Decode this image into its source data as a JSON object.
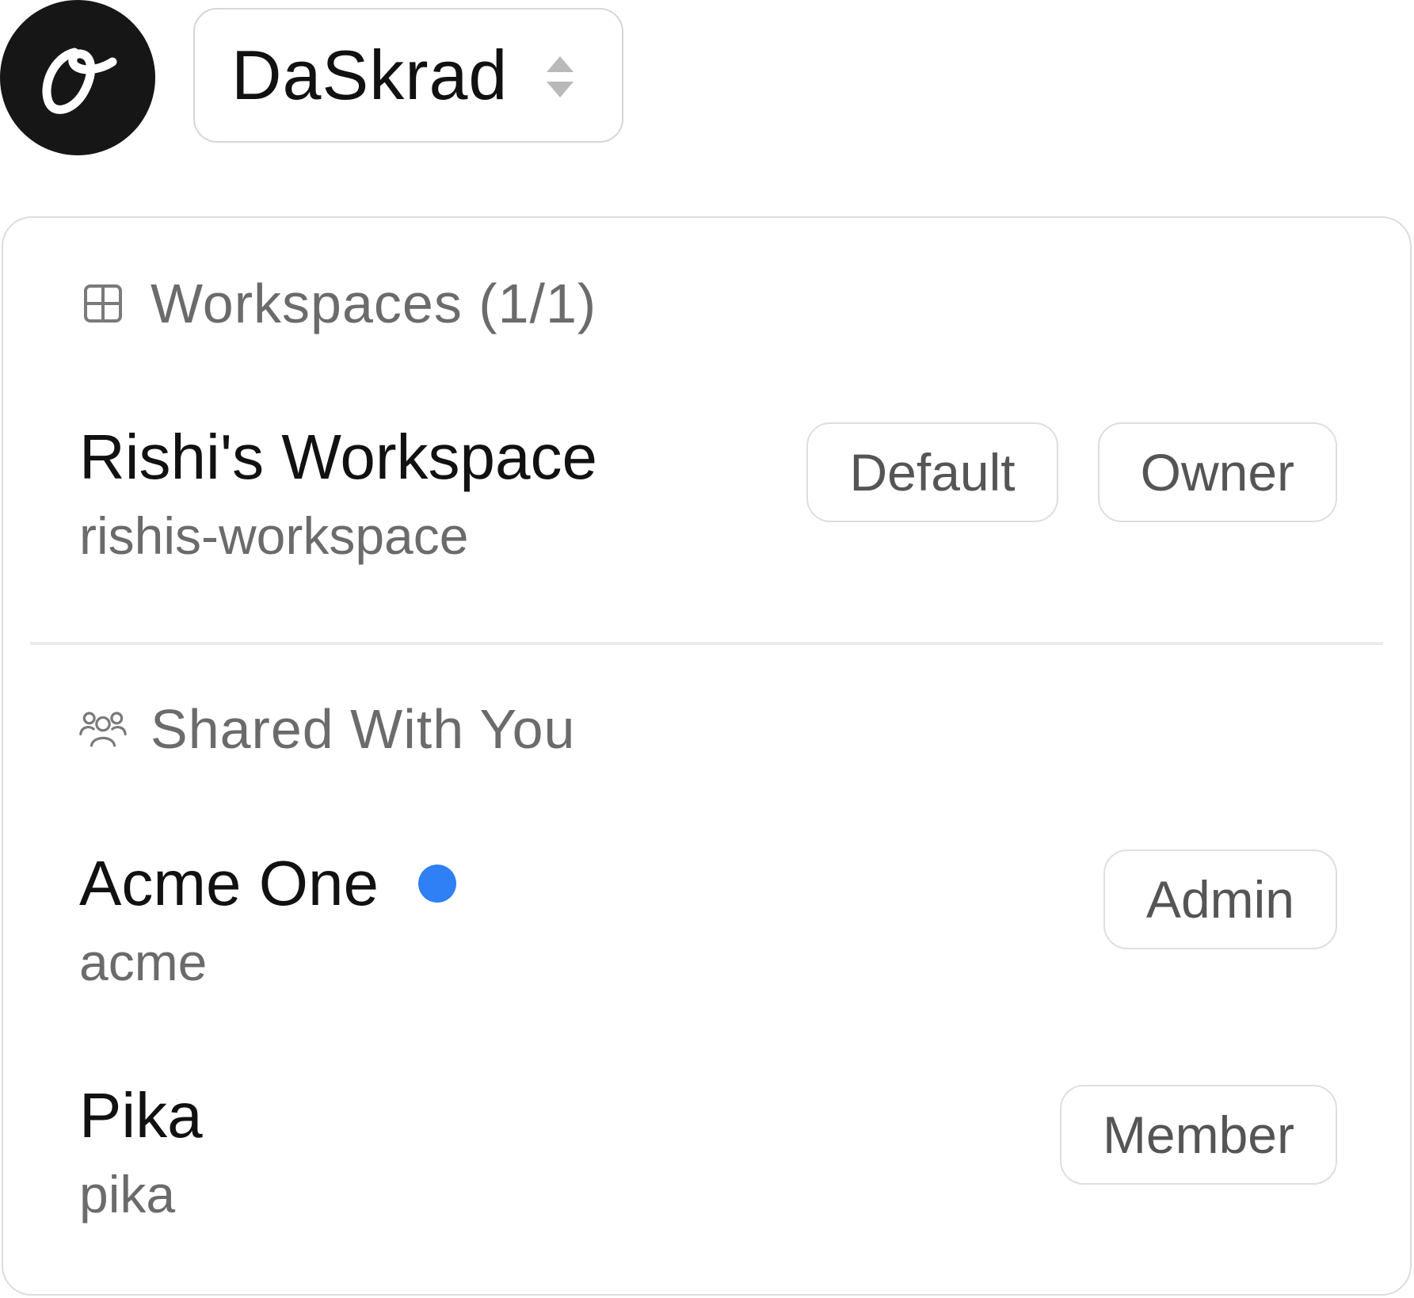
{
  "header": {
    "logo_icon": "script-o-logo-icon",
    "org_name": "DaSkrad",
    "switcher_icon": "sort-updown-icon"
  },
  "workspaces_section": {
    "icon": "grid-icon",
    "title": "Workspaces (1/1)",
    "items": [
      {
        "name": "Rishi's Workspace",
        "slug": "rishis-workspace",
        "badges": [
          "Default",
          "Owner"
        ]
      }
    ]
  },
  "shared_section": {
    "icon": "users-icon",
    "title": "Shared With You",
    "items": [
      {
        "name": "Acme One",
        "slug": "acme",
        "active_indicator_color": "#2f7ff5",
        "badges": [
          "Admin"
        ]
      },
      {
        "name": "Pika",
        "slug": "pika",
        "badges": [
          "Member"
        ]
      }
    ]
  }
}
